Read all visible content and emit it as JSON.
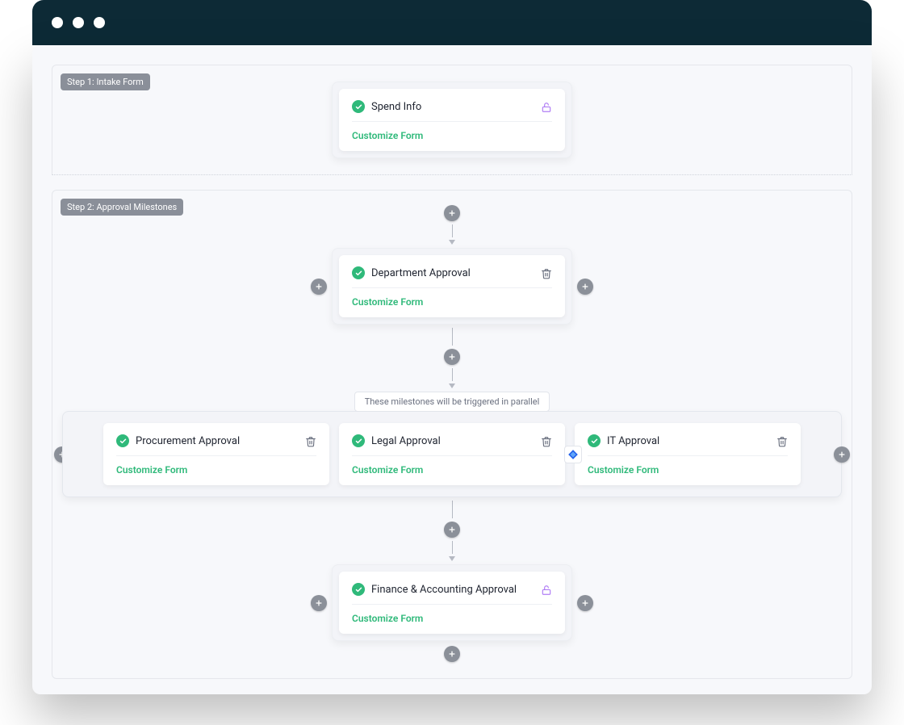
{
  "steps": {
    "intake": {
      "label": "Step 1: Intake Form"
    },
    "approvals": {
      "label": "Step 2: Approval Milestones"
    }
  },
  "cards": {
    "spend": {
      "title": "Spend Info",
      "action": "Customize Form"
    },
    "dept": {
      "title": "Department Approval",
      "action": "Customize Form"
    },
    "procurement": {
      "title": "Procurement Approval",
      "action": "Customize Form"
    },
    "legal": {
      "title": "Legal Approval",
      "action": "Customize Form"
    },
    "it": {
      "title": "IT Approval",
      "action": "Customize Form"
    },
    "finance": {
      "title": "Finance & Accounting Approval",
      "action": "Customize Form"
    }
  },
  "parallelNote": "These milestones will be triggered in parallel"
}
